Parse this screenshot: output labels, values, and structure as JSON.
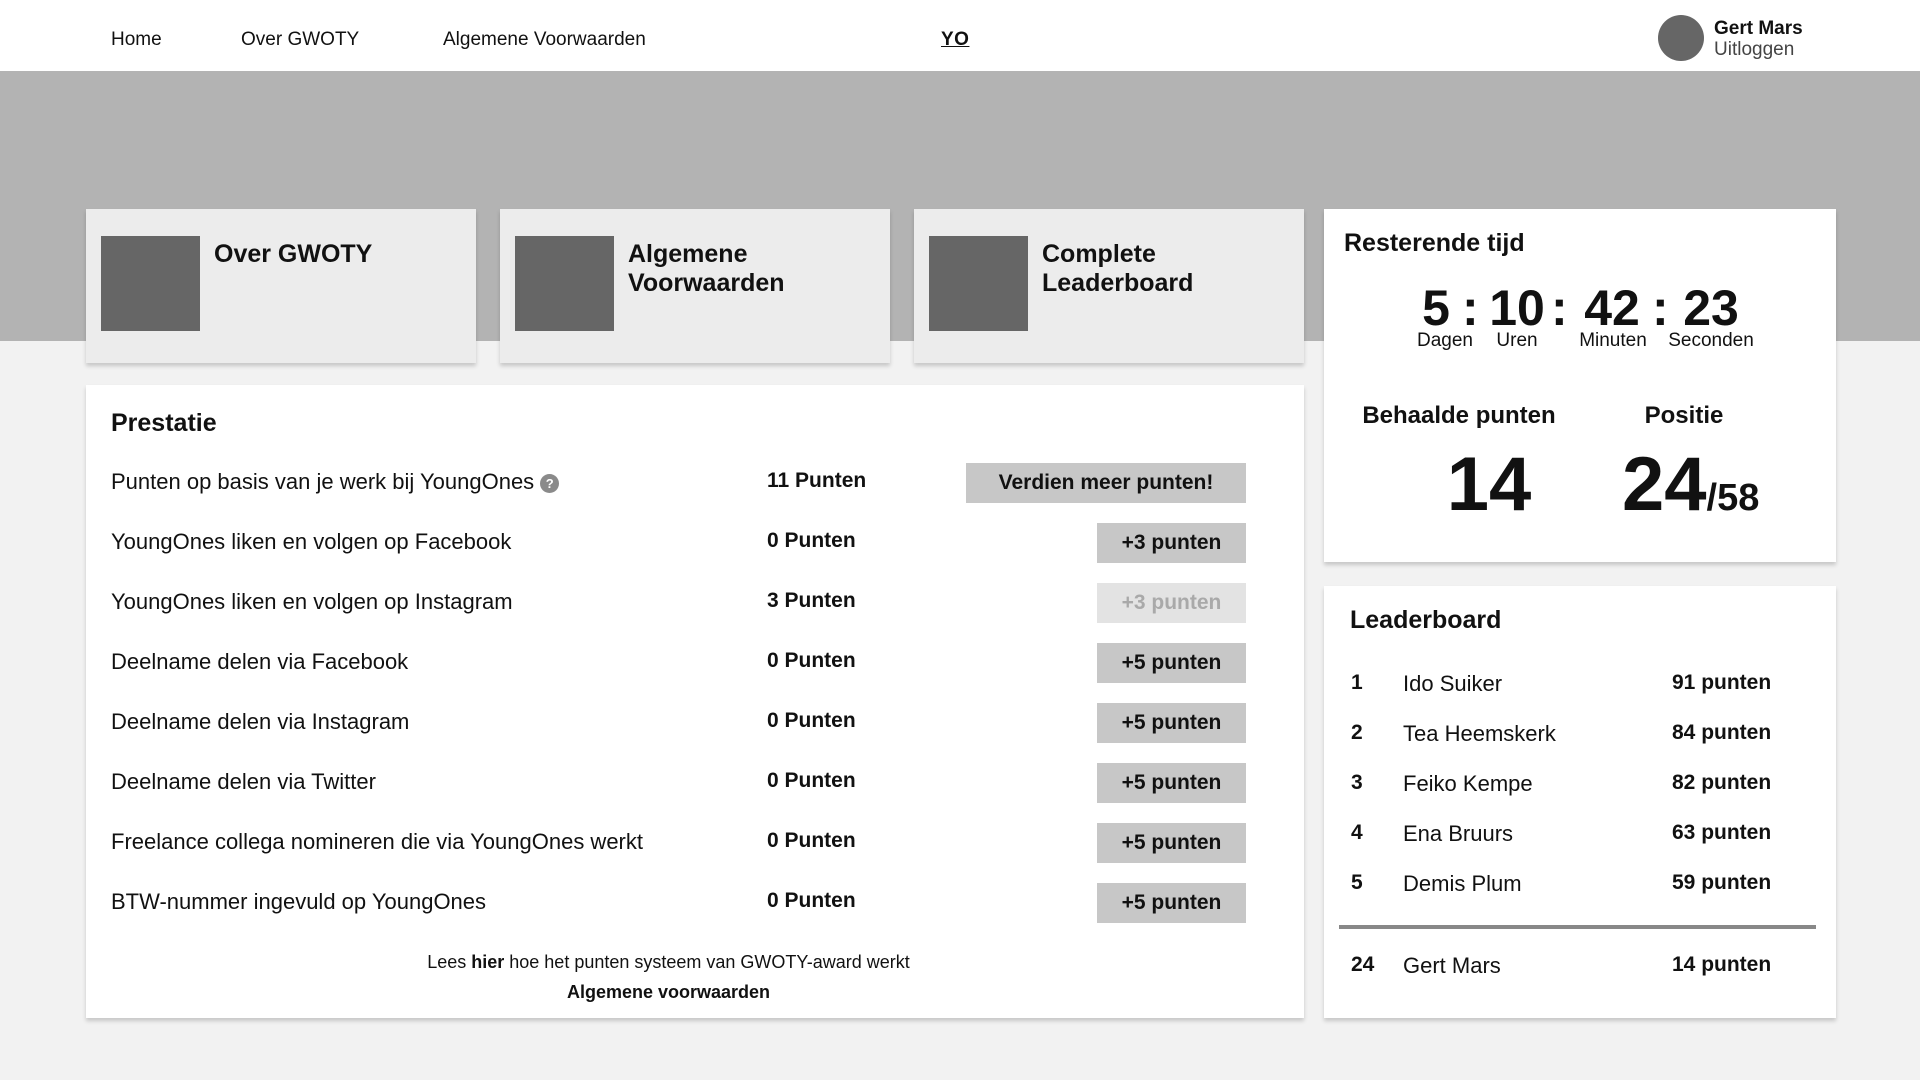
{
  "nav": {
    "home": "Home",
    "over": "Over GWOTY",
    "voorwaarden": "Algemene Voorwaarden",
    "logo": "YO",
    "user_name": "Gert Mars",
    "logout": "Uitloggen"
  },
  "tiles": [
    {
      "title": "Over GWOTY"
    },
    {
      "title": "Algemene Voorwaarden"
    },
    {
      "title": "Complete Leaderboard"
    }
  ],
  "prestatie": {
    "title": "Prestatie",
    "rows": [
      {
        "task": "Punten op basis van je werk bij YoungOnes",
        "help": "?",
        "points": "11 Punten",
        "button": "Verdien meer punten!"
      },
      {
        "task": "YoungOnes liken en volgen op Facebook",
        "points": "0 Punten",
        "button": "+3 punten"
      },
      {
        "task": "YoungOnes liken en volgen op Instagram",
        "points": "3 Punten",
        "button": "+3 punten"
      },
      {
        "task": "Deelname delen via Facebook",
        "points": "0 Punten",
        "button": "+5 punten"
      },
      {
        "task": "Deelname delen via Instagram",
        "points": "0 Punten",
        "button": "+5 punten"
      },
      {
        "task": "Deelname delen via Twitter",
        "points": "0 Punten",
        "button": "+5 punten"
      },
      {
        "task": "Freelance collega nomineren die via YoungOnes werkt",
        "points": "0 Punten",
        "button": "+5 punten"
      },
      {
        "task": "BTW-nummer ingevuld op YoungOnes",
        "points": "0 Punten",
        "button": "+5 punten"
      }
    ],
    "info_pre": "Lees ",
    "info_link": "hier",
    "info_post": " hoe het punten systeem van GWOTY-award werkt",
    "terms": "Algemene voorwaarden"
  },
  "timer": {
    "title": "Resterende tijd",
    "days": "5",
    "hours": "10",
    "minutes": "42",
    "seconds": "23",
    "separator": ":",
    "days_label": "Dagen",
    "hours_label": "Uren",
    "minutes_label": "Minuten",
    "seconds_label": "Seconden",
    "points_label": "Behaalde punten",
    "position_label": "Positie",
    "points": "14",
    "position": "24",
    "position_total": "/58"
  },
  "leaderboard": {
    "title": "Leaderboard",
    "entries": [
      {
        "rank": "1",
        "name": "Ido Suiker",
        "points": "91 punten"
      },
      {
        "rank": "2",
        "name": "Tea Heemskerk",
        "points": "84 punten"
      },
      {
        "rank": "3",
        "name": "Feiko Kempe",
        "points": "82 punten"
      },
      {
        "rank": "4",
        "name": "Ena Bruurs",
        "points": "63 punten"
      },
      {
        "rank": "5",
        "name": "Demis Plum",
        "points": "59 punten"
      }
    ],
    "me": {
      "rank": "24",
      "name": "Gert Mars",
      "points": "14 punten"
    }
  },
  "colors": {
    "hero": "#b3b3b3",
    "button": "#c7c7c7",
    "button_disabled": "#e3e3e3",
    "thumb": "#666666",
    "page_bg": "#f2f2f2"
  }
}
